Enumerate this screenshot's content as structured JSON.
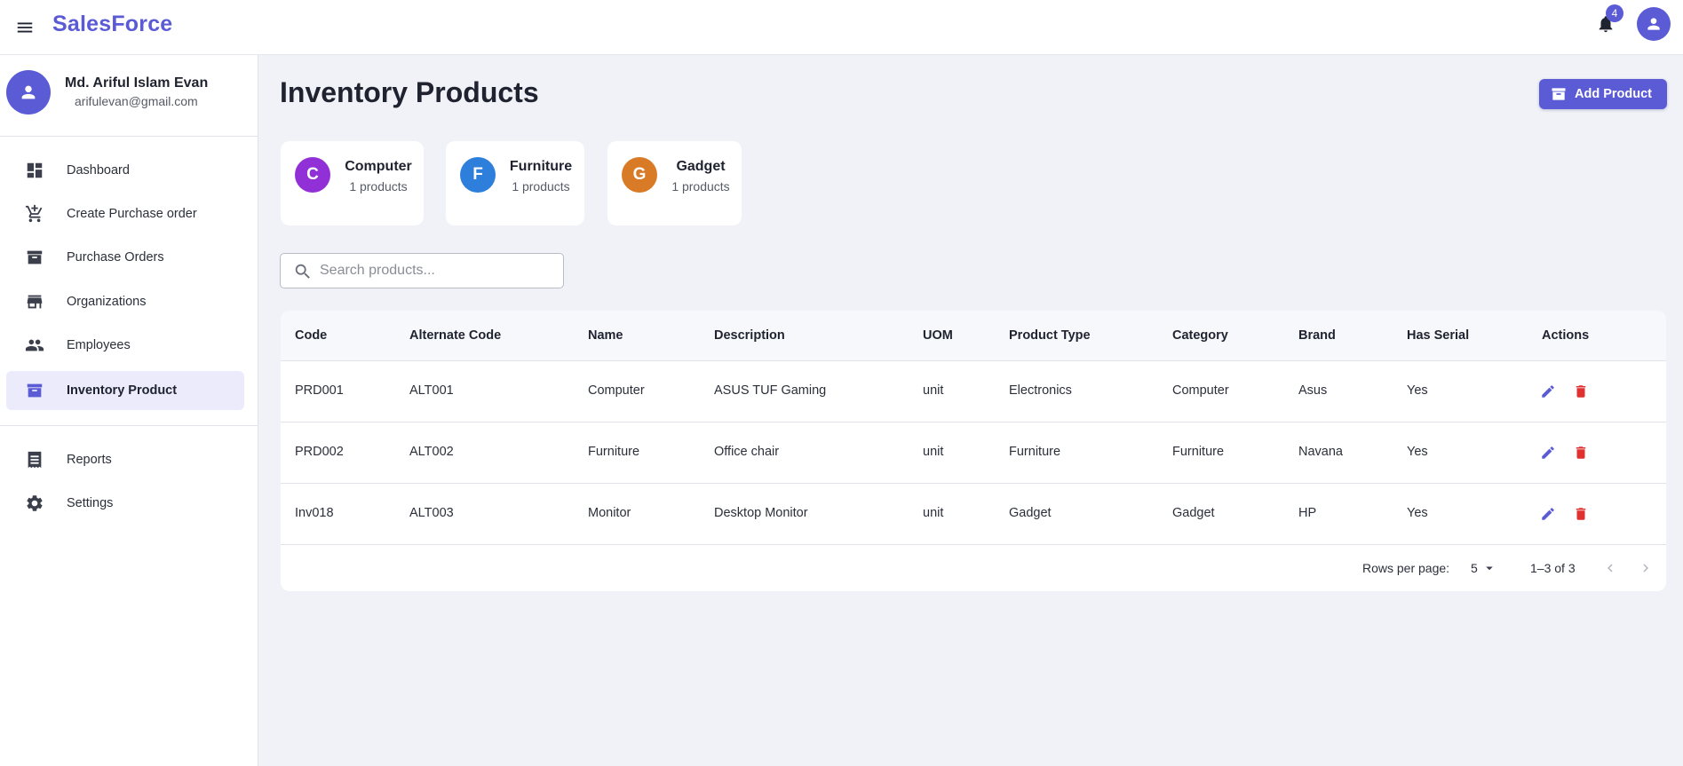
{
  "app": {
    "brand": "SalesForce",
    "notification_count": "4"
  },
  "user": {
    "name": "Md. Ariful Islam Evan",
    "email": "arifulevan@gmail.com"
  },
  "sidebar": {
    "items": [
      {
        "label": "Dashboard",
        "icon": "dashboard-icon"
      },
      {
        "label": "Create Purchase order",
        "icon": "add-cart-icon"
      },
      {
        "label": "Purchase Orders",
        "icon": "archive-icon"
      },
      {
        "label": "Organizations",
        "icon": "store-icon"
      },
      {
        "label": "Employees",
        "icon": "people-icon"
      },
      {
        "label": "Inventory Product",
        "icon": "inventory-icon",
        "active": true
      },
      {
        "label": "Reports",
        "icon": "receipt-icon"
      },
      {
        "label": "Settings",
        "icon": "gear-icon"
      }
    ]
  },
  "main": {
    "title": "Inventory Products",
    "add_button": "Add Product",
    "search": {
      "placeholder": "Search products..."
    }
  },
  "categories": [
    {
      "initial": "C",
      "name": "Computer",
      "count": "1 products",
      "color": "#9230d8"
    },
    {
      "initial": "F",
      "name": "Furniture",
      "count": "1 products",
      "color": "#2d7fdb"
    },
    {
      "initial": "G",
      "name": "Gadget",
      "count": "1 products",
      "color": "#d97b26"
    }
  ],
  "table": {
    "columns": [
      "Code",
      "Alternate Code",
      "Name",
      "Description",
      "UOM",
      "Product Type",
      "Category",
      "Brand",
      "Has Serial",
      "Actions"
    ],
    "rows": [
      {
        "code": "PRD001",
        "alt_code": "ALT001",
        "name": "Computer",
        "description": "ASUS TUF Gaming",
        "uom": "unit",
        "type": "Electronics",
        "category": "Computer",
        "brand": "Asus",
        "serial": "Yes"
      },
      {
        "code": "PRD002",
        "alt_code": "ALT002",
        "name": "Furniture",
        "description": "Office chair",
        "uom": "unit",
        "type": "Furniture",
        "category": "Furniture",
        "brand": "Navana",
        "serial": "Yes"
      },
      {
        "code": "Inv018",
        "alt_code": "ALT003",
        "name": "Monitor",
        "description": "Desktop Monitor",
        "uom": "unit",
        "type": "Gadget",
        "category": "Gadget",
        "brand": "HP",
        "serial": "Yes"
      }
    ]
  },
  "pagination": {
    "rows_per_page_label": "Rows per page:",
    "rows_per_page": "5",
    "range": "1–3 of 3"
  },
  "colors": {
    "accent": "#5b5bd6",
    "edit": "#5b5bd6",
    "delete": "#e03131",
    "background": "#f0f2f7"
  }
}
